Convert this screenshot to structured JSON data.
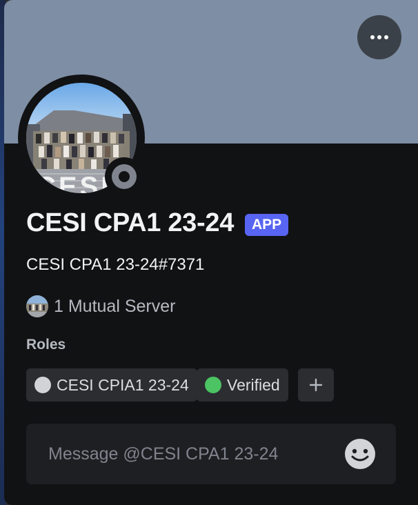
{
  "profile": {
    "display_name": "CESI CPA1 23-24",
    "badge": "APP",
    "username": "CESI CPA1 23-24#7371",
    "avatar_overlay_text": "CESI",
    "status": "offline"
  },
  "mutual": {
    "label": "1 Mutual Server"
  },
  "roles": {
    "heading": "Roles",
    "items": [
      {
        "label": "CESI CPIA1 23-24",
        "color": "#d1d3d6"
      },
      {
        "label": "Verified",
        "color": "#4cc463"
      }
    ],
    "add_icon": "plus-icon"
  },
  "message": {
    "placeholder": "Message @CESI CPA1 23-24"
  },
  "colors": {
    "banner": "#7e8ea4",
    "card": "#111214",
    "badge": "#5865f2",
    "status_offline": "#80848e"
  },
  "icons": {
    "more": "more-options-icon",
    "emoji": "emoji-icon"
  }
}
